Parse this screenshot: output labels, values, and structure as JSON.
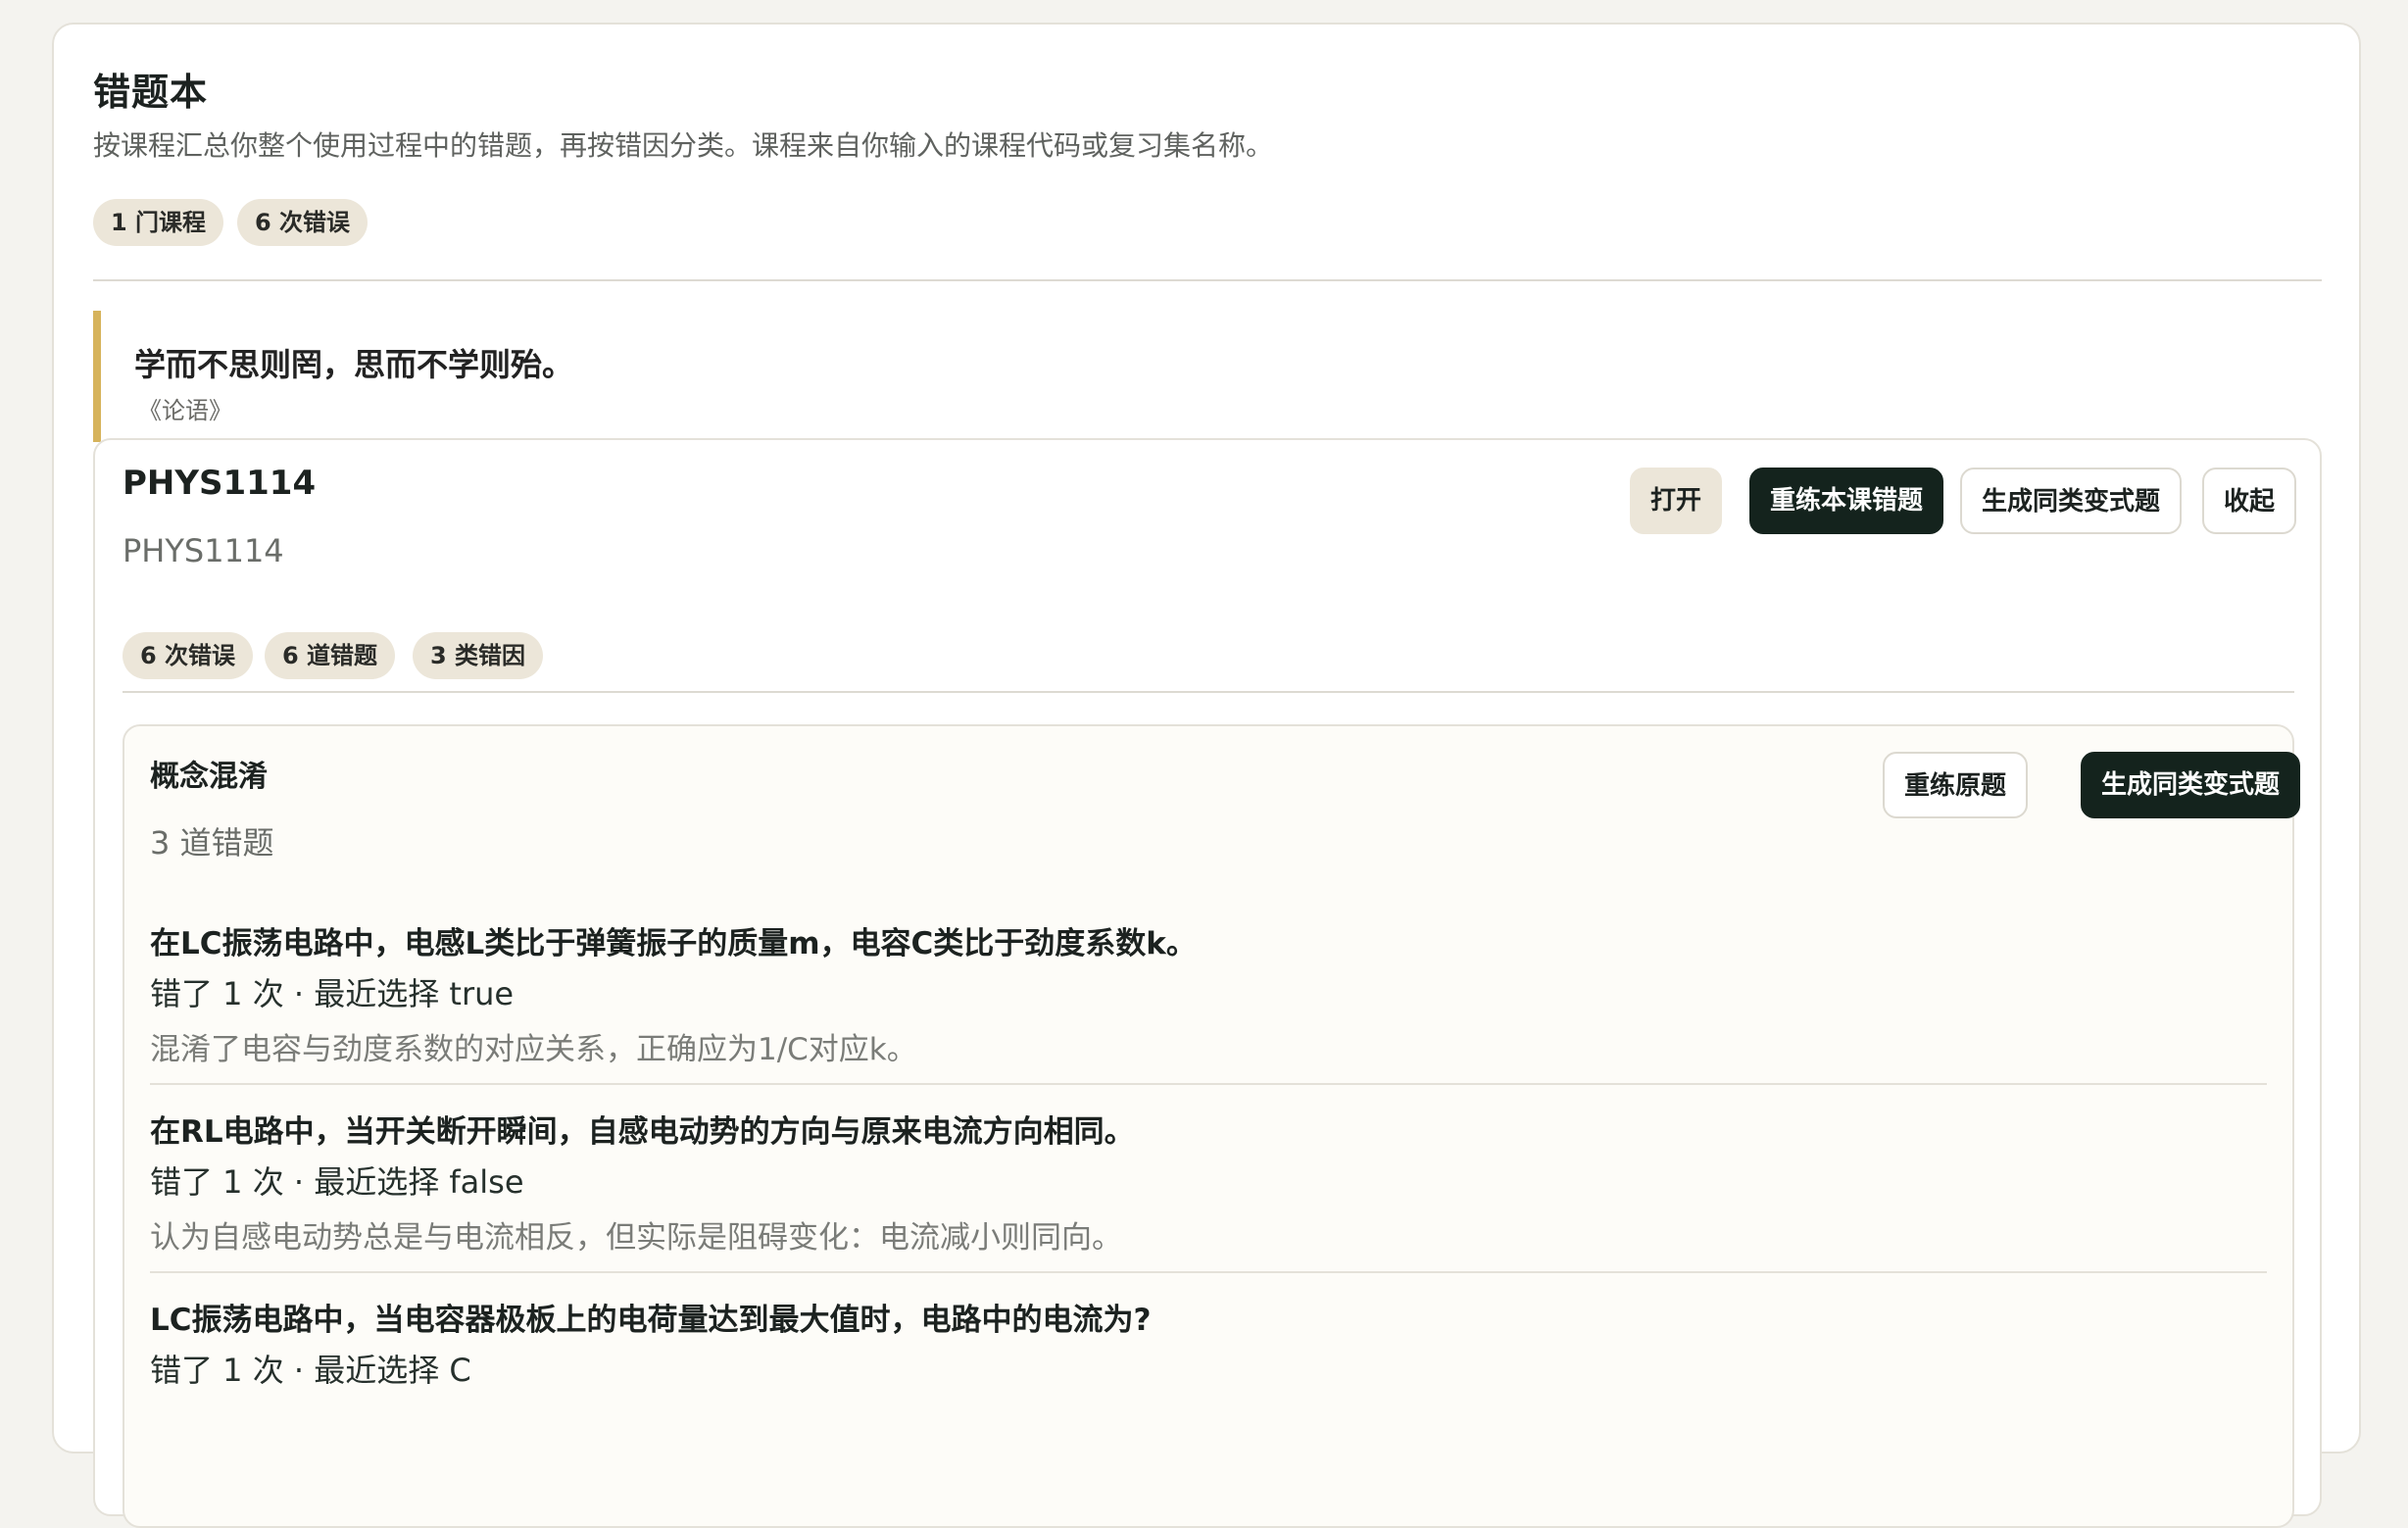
{
  "page": {
    "title": "错题本",
    "subtitle": "按课程汇总你整个使用过程中的错题，再按错因分类。课程来自你输入的课程代码或复习集名称。",
    "badges": [
      "1 门课程",
      "6 次错误"
    ]
  },
  "quote": {
    "text": "学而不思则罔，思而不学则殆。",
    "source": "《论语》"
  },
  "course": {
    "code": "PHYS1114",
    "name": "PHYS1114",
    "badges": [
      "6 次错误",
      "6 道错题",
      "3 类错因"
    ],
    "actions": {
      "open": "打开",
      "retry_course": "重练本课错题",
      "generate_variants": "生成同类变式题",
      "collapse": "收起"
    },
    "groups": [
      {
        "title": "概念混淆",
        "count": "3 道错题",
        "actions": {
          "retry_original": "重练原题",
          "generate_variants": "生成同类变式题"
        },
        "items": [
          {
            "question": "在LC振荡电路中，电感L类比于弹簧振子的质量m，电容C类比于劲度系数k。",
            "meta": "错了 1 次 · 最近选择 true",
            "note": "混淆了电容与劲度系数的对应关系，正确应为1/C对应k。"
          },
          {
            "question": "在RL电路中，当开关断开瞬间，自感电动势的方向与原来电流方向相同。",
            "meta": "错了 1 次 · 最近选择 false",
            "note": "认为自感电动势总是与电流相反，但实际是阻碍变化：电流减小则同向。"
          },
          {
            "question": "LC振荡电路中，当电容器极板上的电荷量达到最大值时，电路中的电流为?",
            "meta": "错了 1 次 · 最近选择 C",
            "note": ""
          }
        ]
      }
    ]
  },
  "colors": {
    "background": "#f4f3ef",
    "panel": "#ffffff",
    "pill": "#ece6d9",
    "dark_button": "#14231d",
    "quote_accent": "#d6b35b"
  }
}
